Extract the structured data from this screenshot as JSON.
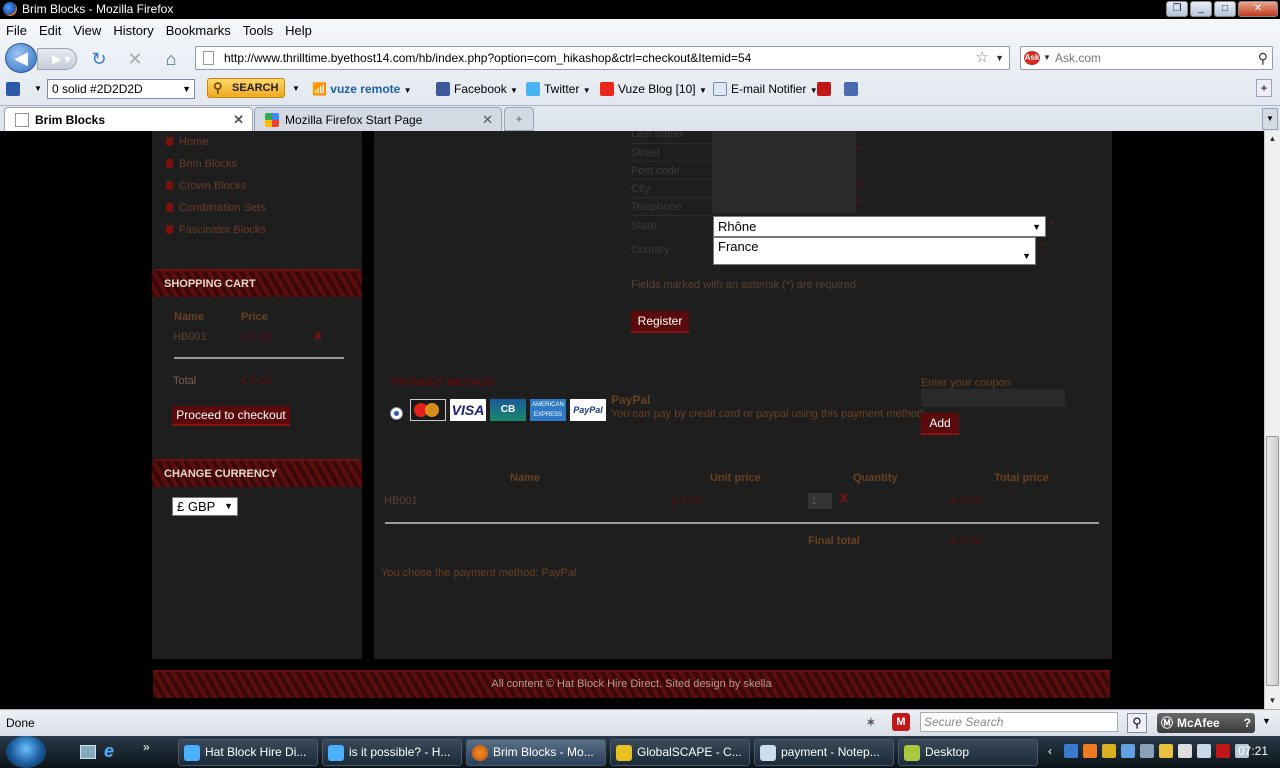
{
  "window": {
    "title": "Brim Blocks - Mozilla Firefox"
  },
  "menu": [
    "File",
    "Edit",
    "View",
    "History",
    "Bookmarks",
    "Tools",
    "Help"
  ],
  "url": "http://www.thrilltime.byethost14.com/hb/index.php?option=com_hikashop&ctrl=checkout&Itemid=54",
  "search": {
    "placeholder": "Ask.com"
  },
  "toolbar": {
    "combo_value": "0 solid #2D2D2D",
    "search_label": "SEARCH",
    "vuze_label": "vuze remote",
    "facebook_label": "Facebook",
    "twitter_label": "Twitter",
    "vuze_blog_label": "Vuze Blog [10]",
    "email_label": "E-mail Notifier"
  },
  "tabs": [
    {
      "label": "Brim Blocks",
      "active": true
    },
    {
      "label": "Mozilla Firefox Start Page",
      "active": false
    }
  ],
  "sidebar": {
    "nav": [
      "Home",
      "Brim Blocks",
      "Crown Blocks",
      "Combination Sets",
      "Fascinator Blocks"
    ],
    "cart_title": "SHOPPING CART",
    "cart_headers": {
      "name": "Name",
      "price": "Price"
    },
    "cart_item": {
      "name": "HB001",
      "price": "£ 5.00",
      "remove": "X"
    },
    "total_label": "Total",
    "total_value": "£ 5.00",
    "checkout_label": "Proceed to checkout",
    "currency_title": "CHANGE CURRENCY",
    "currency_value": "£ GBP"
  },
  "form": {
    "labels": [
      "Last name",
      "Street",
      "Post code",
      "City",
      "Telephone",
      "State",
      "Country"
    ],
    "state_value": "Rhône",
    "country_value": "France",
    "required_note": "Fields marked with an asterisk (*) are required.",
    "register_label": "Register",
    "asterisk": "*"
  },
  "payment": {
    "heading": "PAYMENT METHOD",
    "name": "PayPal",
    "description": "You can pay by credit card or paypal using this payment method",
    "card_logos": [
      "MasterCard",
      "VISA",
      "CB",
      "AMERICAN EXPRESS",
      "PayPal"
    ],
    "coupon_label": "Enter your coupon",
    "add_label": "Add"
  },
  "order": {
    "headers": [
      "Name",
      "Unit price",
      "Quantity",
      "Total price"
    ],
    "row": {
      "name": "HB001",
      "unit_price": "£ 5.00",
      "quantity": "1",
      "remove": "X",
      "total": "£ 5.00"
    },
    "final_label": "Final total",
    "final_value": "£ 5.00",
    "chosen": "You chose the payment method: PayPal"
  },
  "footer": {
    "text": "All content © Hat Block Hire Direct. Sited design by skella"
  },
  "statusbar": {
    "status": "Done",
    "secure_search": "Secure Search",
    "mcafee": "McAfee"
  },
  "taskbar": {
    "items": [
      "Hat Block Hire Di...",
      "is it possible? - H...",
      "Brim Blocks - Mo...",
      "GlobalSCAPE - C...",
      "payment - Notep...",
      "Desktop"
    ],
    "clock": "07:21"
  }
}
